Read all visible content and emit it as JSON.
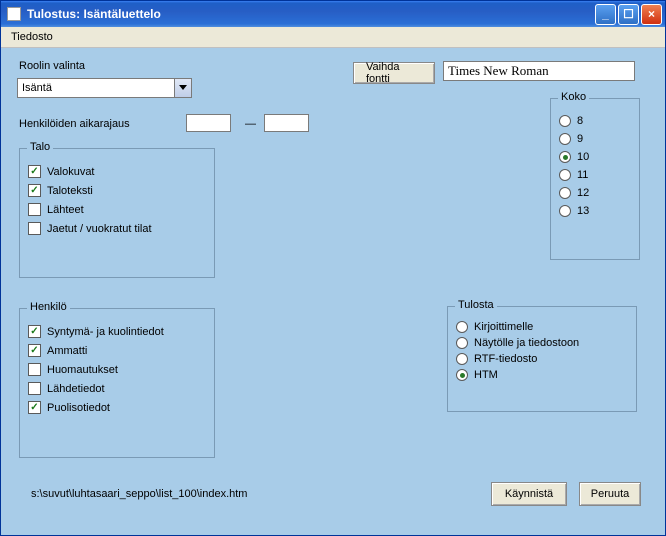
{
  "window": {
    "title": "Tulostus: Isäntäluettelo"
  },
  "menubar": {
    "file": "Tiedosto"
  },
  "labels": {
    "roolin_valinta": "Roolin valinta",
    "aikarajaus": "Henkilöiden aikarajaus",
    "aikarajaus_sep": "—"
  },
  "role_dropdown": {
    "value": "Isäntä"
  },
  "date_from": {
    "value": ""
  },
  "date_to": {
    "value": ""
  },
  "vaihda_fontti_btn": "Vaihda fontti",
  "font_name": "Times New Roman",
  "koko": {
    "legend": "Koko",
    "options": [
      "8",
      "9",
      "10",
      "11",
      "12",
      "13"
    ],
    "selected": "10"
  },
  "talo": {
    "legend": "Talo",
    "items": [
      {
        "label": "Valokuvat",
        "checked": true
      },
      {
        "label": "Taloteksti",
        "checked": true
      },
      {
        "label": "Lähteet",
        "checked": false
      },
      {
        "label": "Jaetut / vuokratut tilat",
        "checked": false
      }
    ]
  },
  "henkilo": {
    "legend": "Henkilö",
    "items": [
      {
        "label": "Syntymä- ja kuolintiedot",
        "checked": true
      },
      {
        "label": "Ammatti",
        "checked": true
      },
      {
        "label": "Huomautukset",
        "checked": false
      },
      {
        "label": "Lähdetiedot",
        "checked": false
      },
      {
        "label": "Puolisotiedot",
        "checked": true
      }
    ]
  },
  "tulosta": {
    "legend": "Tulosta",
    "options": [
      "Kirjoittimelle",
      "Näytölle ja tiedostoon",
      "RTF-tiedosto",
      "HTM"
    ],
    "selected": "HTM"
  },
  "path": "s:\\suvut\\luhtasaari_seppo\\list_100\\index.htm",
  "buttons": {
    "start": "Käynnistä",
    "cancel": "Peruuta"
  }
}
